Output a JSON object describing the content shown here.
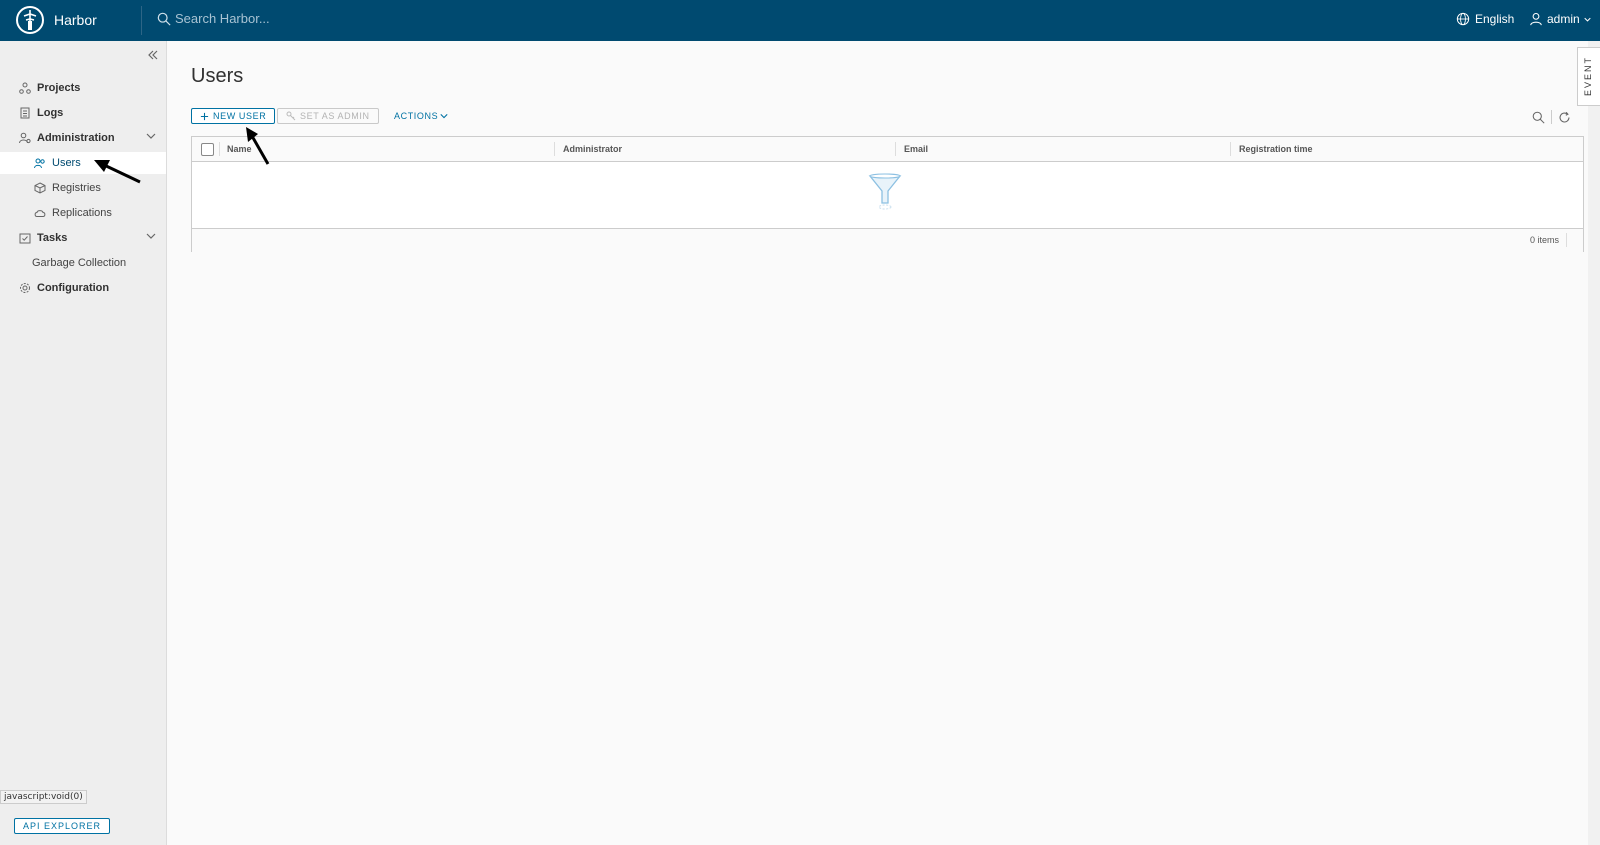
{
  "header": {
    "brand": "Harbor",
    "search_placeholder": "Search Harbor...",
    "language": "English",
    "user": "admin"
  },
  "sidebar": {
    "items": [
      {
        "label": "Projects",
        "icon": "projects-icon"
      },
      {
        "label": "Logs",
        "icon": "logs-icon"
      },
      {
        "label": "Administration",
        "icon": "administration-icon"
      },
      {
        "label": "Users",
        "icon": "users-icon"
      },
      {
        "label": "Registries",
        "icon": "registries-icon"
      },
      {
        "label": "Replications",
        "icon": "replications-icon"
      },
      {
        "label": "Tasks",
        "icon": "tasks-icon"
      },
      {
        "label": "Garbage Collection",
        "icon": ""
      },
      {
        "label": "Configuration",
        "icon": "configuration-icon"
      }
    ],
    "api_explorer": "API EXPLORER"
  },
  "main": {
    "title": "Users",
    "toolbar": {
      "new_user": "NEW USER",
      "set_as_admin": "SET AS ADMIN",
      "actions": "ACTIONS"
    },
    "table": {
      "columns": [
        "Name",
        "Administrator",
        "Email",
        "Registration time"
      ],
      "rows": [],
      "footer": "0 items"
    }
  },
  "event_tab": "EVENT",
  "status_bar": "javascript:void(0)",
  "colors": {
    "header": "#004a70",
    "accent": "#0072a3",
    "sidebar": "#eeeeee"
  }
}
